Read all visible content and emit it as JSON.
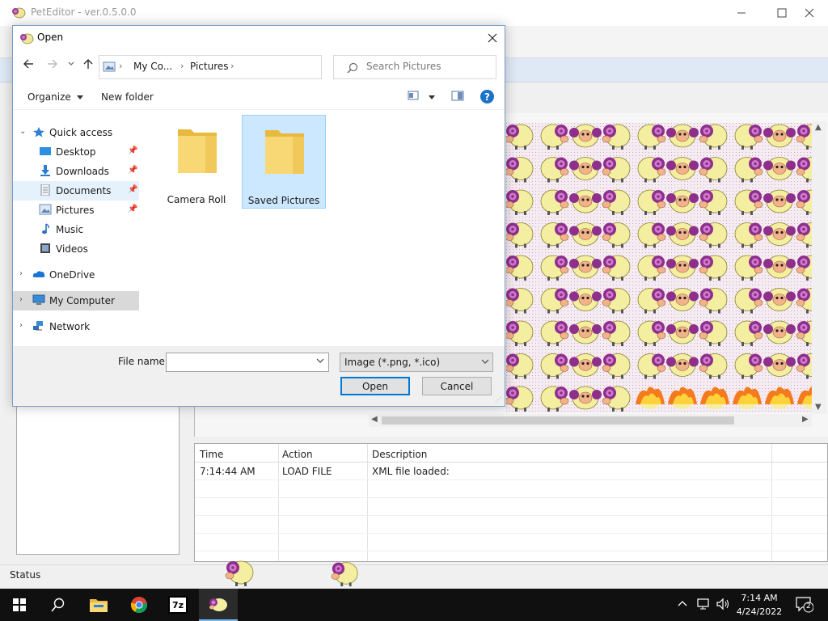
{
  "app": {
    "title": "PetEditor - ver.0.5.0.0",
    "status": "Status",
    "log": {
      "columns": [
        "Time",
        "Action",
        "Description"
      ],
      "rows": [
        {
          "time": "7:14:44 AM",
          "action": "LOAD FILE",
          "description": "XML file loaded:"
        }
      ]
    }
  },
  "dialog": {
    "title": "Open",
    "address": {
      "crumbs": [
        "My Co...",
        "Pictures"
      ]
    },
    "search_placeholder": "Search Pictures",
    "commands": {
      "organize": "Organize",
      "new_folder": "New folder"
    },
    "nav": {
      "quick_access": "Quick access",
      "desktop": "Desktop",
      "downloads": "Downloads",
      "documents": "Documents",
      "pictures": "Pictures",
      "music": "Music",
      "videos": "Videos",
      "onedrive": "OneDrive",
      "my_computer": "My Computer",
      "network": "Network"
    },
    "folders": {
      "camera_roll": "Camera Roll",
      "saved_pictures": "Saved Pictures"
    },
    "file_name_label": "File name:",
    "file_name_value": "",
    "file_type": "Image (*.png, *.ico)",
    "open_label": "Open",
    "cancel_label": "Cancel"
  },
  "taskbar": {
    "time": "7:14 AM",
    "date": "4/24/2022",
    "notification_count": "2",
    "zip_label": "7z"
  },
  "colors": {
    "accent": "#0078d7",
    "folder": "#f8d775",
    "selection": "#cce8ff",
    "sprite_wool": "#f4eea0",
    "sprite_horn": "#8e2f8c"
  }
}
